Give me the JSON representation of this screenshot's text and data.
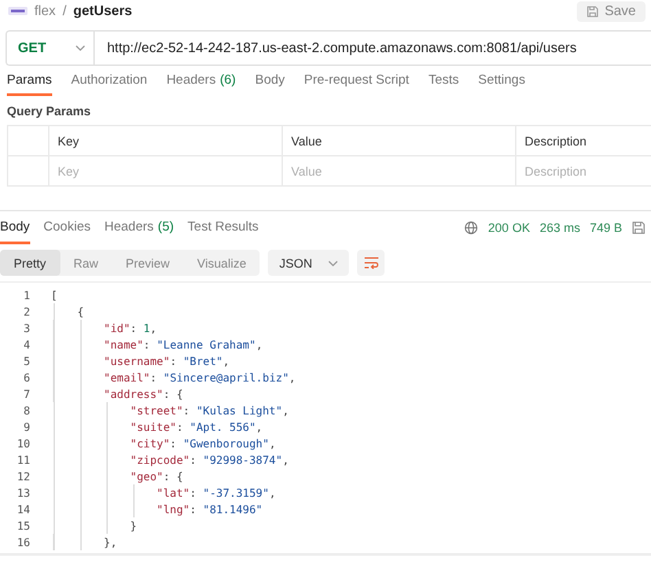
{
  "header": {
    "breadcrumb": [
      {
        "text": "flex"
      },
      {
        "text": "getUsers"
      }
    ],
    "separator": "/",
    "save": "Save"
  },
  "request": {
    "method": "GET",
    "url": "http://ec2-52-14-242-187.us-east-2.compute.amazonaws.com:8081/api/users"
  },
  "request_tabs": [
    {
      "label": "Params",
      "selected": true
    },
    {
      "label": "Authorization",
      "selected": false
    },
    {
      "label": "Headers",
      "count": "(6)",
      "selected": false
    },
    {
      "label": "Body",
      "selected": false
    },
    {
      "label": "Pre-request Script",
      "selected": false
    },
    {
      "label": "Tests",
      "selected": false
    },
    {
      "label": "Settings",
      "selected": false
    }
  ],
  "query_params": {
    "title": "Query Params",
    "columns": [
      "Key",
      "Value",
      "Description"
    ],
    "placeholders": [
      "Key",
      "Value",
      "Description"
    ]
  },
  "response_tabs": [
    {
      "label": "Body",
      "selected": true
    },
    {
      "label": "Cookies",
      "selected": false
    },
    {
      "label": "Headers",
      "count": "(5)",
      "selected": false
    },
    {
      "label": "Test Results",
      "selected": false
    }
  ],
  "response_status": {
    "status": "200 OK",
    "time": "263 ms",
    "size": "749 B"
  },
  "view_modes": [
    {
      "label": "Pretty",
      "selected": true
    },
    {
      "label": "Raw",
      "selected": false
    },
    {
      "label": "Preview",
      "selected": false
    },
    {
      "label": "Visualize",
      "selected": false
    }
  ],
  "format": "JSON",
  "code_lines": [
    {
      "number": "1",
      "tokens": [
        {
          "kind": "punct",
          "text": "["
        }
      ],
      "children": [
        {
          "number": "2",
          "tokens": [
            {
              "kind": "punct",
              "text": "{"
            }
          ],
          "children": [
            {
              "number": "3",
              "tokens": [
                {
                  "kind": "key",
                  "text": "\"id\""
                },
                {
                  "kind": "punct",
                  "text": ": "
                },
                {
                  "kind": "number",
                  "text": "1"
                },
                {
                  "kind": "punct",
                  "text": ","
                }
              ]
            },
            {
              "number": "4",
              "tokens": [
                {
                  "kind": "key",
                  "text": "\"name\""
                },
                {
                  "kind": "punct",
                  "text": ": "
                },
                {
                  "kind": "string",
                  "text": "\"Leanne Graham\""
                },
                {
                  "kind": "punct",
                  "text": ","
                }
              ]
            },
            {
              "number": "5",
              "tokens": [
                {
                  "kind": "key",
                  "text": "\"username\""
                },
                {
                  "kind": "punct",
                  "text": ": "
                },
                {
                  "kind": "string",
                  "text": "\"Bret\""
                },
                {
                  "kind": "punct",
                  "text": ","
                }
              ]
            },
            {
              "number": "6",
              "tokens": [
                {
                  "kind": "key",
                  "text": "\"email\""
                },
                {
                  "kind": "punct",
                  "text": ": "
                },
                {
                  "kind": "string",
                  "text": "\"Sincere@april.biz\""
                },
                {
                  "kind": "punct",
                  "text": ","
                }
              ]
            },
            {
              "number": "7",
              "tokens": [
                {
                  "kind": "key",
                  "text": "\"address\""
                },
                {
                  "kind": "punct",
                  "text": ": {"
                }
              ],
              "children": [
                {
                  "number": "8",
                  "tokens": [
                    {
                      "kind": "key",
                      "text": "\"street\""
                    },
                    {
                      "kind": "punct",
                      "text": ": "
                    },
                    {
                      "kind": "string",
                      "text": "\"Kulas Light\""
                    },
                    {
                      "kind": "punct",
                      "text": ","
                    }
                  ]
                },
                {
                  "number": "9",
                  "tokens": [
                    {
                      "kind": "key",
                      "text": "\"suite\""
                    },
                    {
                      "kind": "punct",
                      "text": ": "
                    },
                    {
                      "kind": "string",
                      "text": "\"Apt. 556\""
                    },
                    {
                      "kind": "punct",
                      "text": ","
                    }
                  ]
                },
                {
                  "number": "10",
                  "tokens": [
                    {
                      "kind": "key",
                      "text": "\"city\""
                    },
                    {
                      "kind": "punct",
                      "text": ": "
                    },
                    {
                      "kind": "string",
                      "text": "\"Gwenborough\""
                    },
                    {
                      "kind": "punct",
                      "text": ","
                    }
                  ]
                },
                {
                  "number": "11",
                  "tokens": [
                    {
                      "kind": "key",
                      "text": "\"zipcode\""
                    },
                    {
                      "kind": "punct",
                      "text": ": "
                    },
                    {
                      "kind": "string",
                      "text": "\"92998-3874\""
                    },
                    {
                      "kind": "punct",
                      "text": ","
                    }
                  ]
                },
                {
                  "number": "12",
                  "tokens": [
                    {
                      "kind": "key",
                      "text": "\"geo\""
                    },
                    {
                      "kind": "punct",
                      "text": ": {"
                    }
                  ],
                  "children": [
                    {
                      "number": "13",
                      "tokens": [
                        {
                          "kind": "key",
                          "text": "\"lat\""
                        },
                        {
                          "kind": "punct",
                          "text": ": "
                        },
                        {
                          "kind": "string",
                          "text": "\"-37.3159\""
                        },
                        {
                          "kind": "punct",
                          "text": ","
                        }
                      ]
                    },
                    {
                      "number": "14",
                      "tokens": [
                        {
                          "kind": "key",
                          "text": "\"lng\""
                        },
                        {
                          "kind": "punct",
                          "text": ": "
                        },
                        {
                          "kind": "string",
                          "text": "\"81.1496\""
                        }
                      ]
                    }
                  ]
                },
                {
                  "number": "15",
                  "tokens": [
                    {
                      "kind": "punct",
                      "text": "}"
                    }
                  ]
                }
              ]
            },
            {
              "number": "16",
              "tokens": [
                {
                  "kind": "punct",
                  "text": "},"
                }
              ]
            }
          ]
        }
      ]
    }
  ]
}
